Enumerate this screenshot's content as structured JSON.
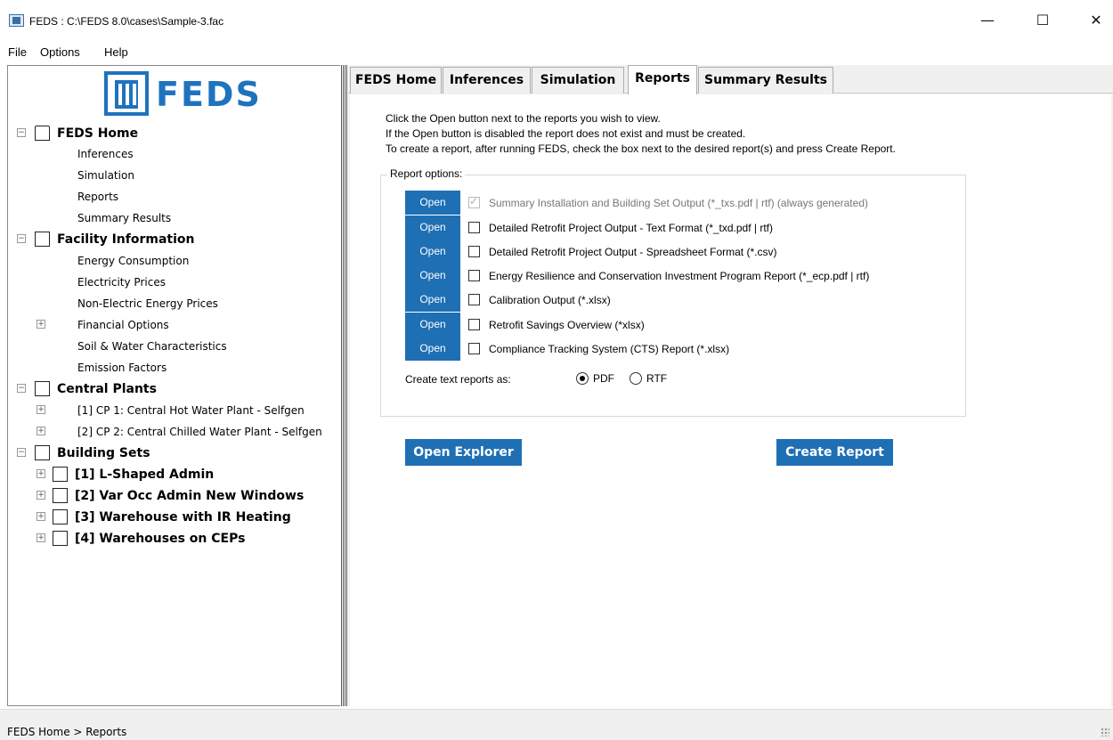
{
  "window": {
    "title": "FEDS : C:\\FEDS 8.0\\cases\\Sample-3.fac",
    "minimize_glyph": "—",
    "maximize_glyph": "☐",
    "close_glyph": "✕"
  },
  "menu": {
    "file": "File",
    "options": "Options",
    "help": "Help"
  },
  "logo": {
    "text": "FEDS"
  },
  "tree": {
    "feds_home": {
      "label": "FEDS Home",
      "children": [
        "Inferences",
        "Simulation",
        "Reports",
        "Summary Results"
      ]
    },
    "facility_info": {
      "label": "Facility Information",
      "children": [
        "Energy Consumption",
        "Electricity Prices",
        "Non-Electric Energy Prices",
        "Financial Options",
        "Soil & Water Characteristics",
        "Emission Factors"
      ]
    },
    "central_plants": {
      "label": "Central Plants",
      "children": [
        "[1]  CP 1: Central Hot Water Plant - Selfgen",
        "[2]  CP 2: Central Chilled Water Plant - Selfgen"
      ]
    },
    "building_sets": {
      "label": "Building Sets",
      "children": [
        "[1]  L-Shaped Admin",
        "[2]  Var Occ Admin New Windows",
        "[3]  Warehouse with IR Heating",
        "[4]  Warehouses on CEPs"
      ]
    }
  },
  "tabs": [
    "FEDS Home",
    "Inferences",
    "Simulation",
    "Reports",
    "Summary Results"
  ],
  "active_tab": "Reports",
  "instructions": [
    "Click the Open button next to the reports you wish to view.",
    "If the Open button is disabled the report does not exist and must be created.",
    "To create a report, after running FEDS, check the box next to the desired report(s) and press Create Report."
  ],
  "report_options": {
    "label": "Report options:",
    "open_label": "Open",
    "items": [
      {
        "label": "Summary Installation and Building Set Output (*_txs.pdf | rtf) (always generated)",
        "checked": true,
        "disabled": true
      },
      {
        "label": "Detailed Retrofit Project Output - Text Format (*_txd.pdf | rtf)",
        "checked": false,
        "disabled": false
      },
      {
        "label": "Detailed Retrofit Project Output - Spreadsheet Format (*.csv)",
        "checked": false,
        "disabled": false
      },
      {
        "label": "Energy Resilience and Conservation Investment Program Report (*_ecp.pdf | rtf)",
        "checked": false,
        "disabled": false
      },
      {
        "label": "Calibration Output (*.xlsx)",
        "checked": false,
        "disabled": false
      },
      {
        "label": "Retrofit Savings Overview (*xlsx)",
        "checked": false,
        "disabled": false
      },
      {
        "label": "Compliance Tracking System (CTS)  Report (*.xlsx)",
        "checked": false,
        "disabled": false
      }
    ],
    "create_as_label": "Create text reports as:",
    "pdf_label": "PDF",
    "rtf_label": "RTF",
    "selected_format": "PDF"
  },
  "buttons": {
    "open_explorer": "Open Explorer",
    "create_report": "Create Report"
  },
  "status": {
    "text": "FEDS Home > Reports"
  },
  "colors": {
    "accent": "#1f6fb5",
    "logo_blue": "#1e73be"
  }
}
